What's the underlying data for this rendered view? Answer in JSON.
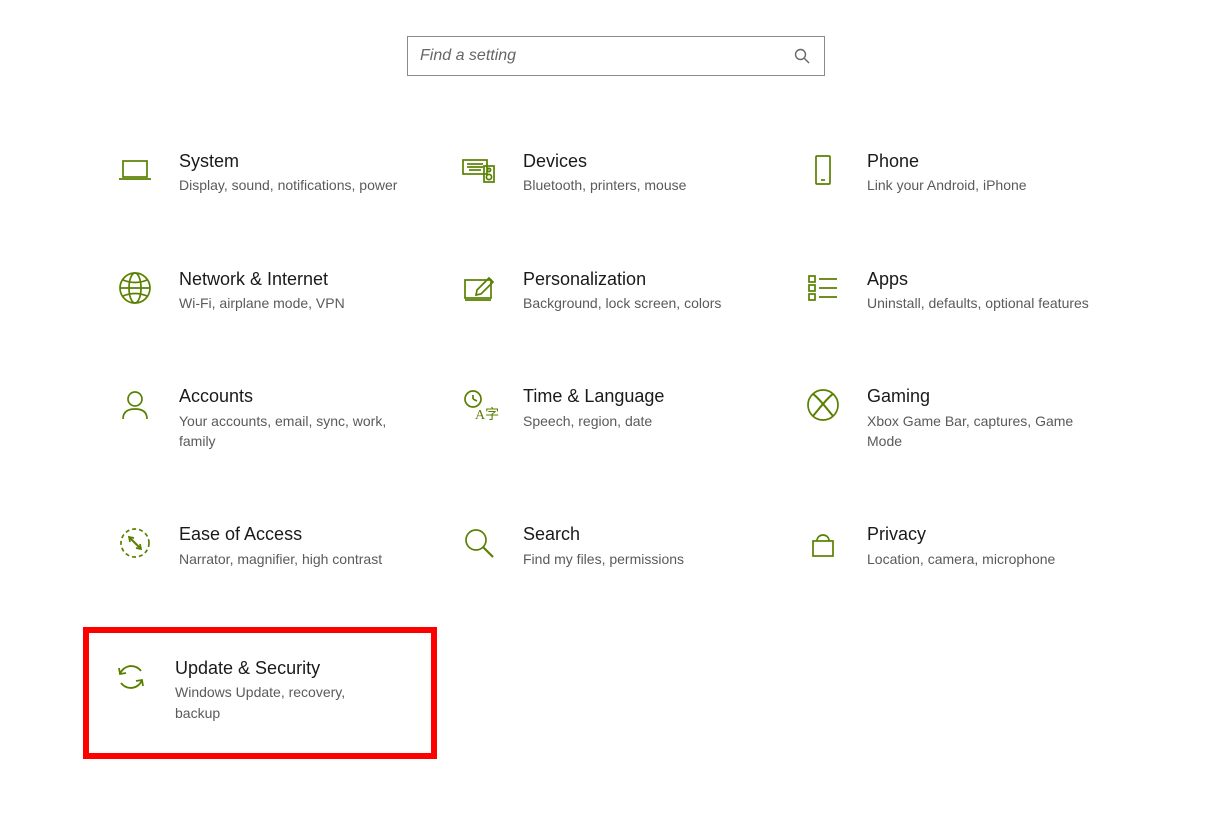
{
  "accent": "#598000",
  "search": {
    "placeholder": "Find a setting"
  },
  "tiles": [
    {
      "id": "system",
      "title": "System",
      "desc": "Display, sound, notifications, power"
    },
    {
      "id": "devices",
      "title": "Devices",
      "desc": "Bluetooth, printers, mouse"
    },
    {
      "id": "phone",
      "title": "Phone",
      "desc": "Link your Android, iPhone"
    },
    {
      "id": "network",
      "title": "Network & Internet",
      "desc": "Wi-Fi, airplane mode, VPN"
    },
    {
      "id": "personalization",
      "title": "Personalization",
      "desc": "Background, lock screen, colors"
    },
    {
      "id": "apps",
      "title": "Apps",
      "desc": "Uninstall, defaults, optional features"
    },
    {
      "id": "accounts",
      "title": "Accounts",
      "desc": "Your accounts, email, sync, work, family"
    },
    {
      "id": "time",
      "title": "Time & Language",
      "desc": "Speech, region, date"
    },
    {
      "id": "gaming",
      "title": "Gaming",
      "desc": "Xbox Game Bar, captures, Game Mode"
    },
    {
      "id": "ease",
      "title": "Ease of Access",
      "desc": "Narrator, magnifier, high contrast"
    },
    {
      "id": "search",
      "title": "Search",
      "desc": "Find my files, permissions"
    },
    {
      "id": "privacy",
      "title": "Privacy",
      "desc": "Location, camera, microphone"
    },
    {
      "id": "update",
      "title": "Update & Security",
      "desc": "Windows Update, recovery, backup",
      "highlighted": true
    }
  ]
}
